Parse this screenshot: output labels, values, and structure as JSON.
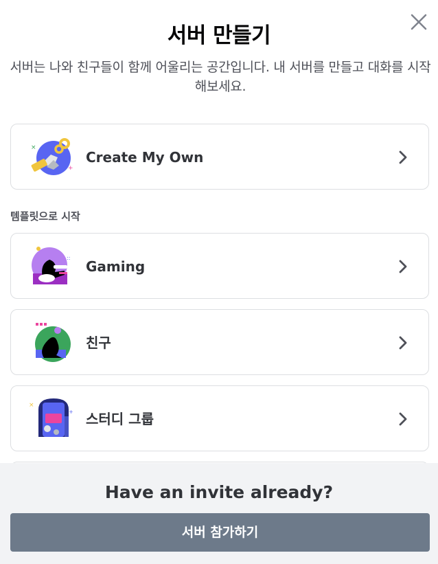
{
  "modal": {
    "title": "서버 만들기",
    "subtitle": "서버는 나와 친구들이 함께 어울리는 공간입니다. 내 서버를 만들고 대화를 시작해보세요.",
    "close_icon": "close-icon"
  },
  "create_own": {
    "label": "Create My Own",
    "icon": "create-server-icon"
  },
  "templates": {
    "heading": "템플릿으로 시작",
    "items": [
      {
        "label": "Gaming",
        "icon": "gaming-icon"
      },
      {
        "label": "친구",
        "icon": "friends-icon"
      },
      {
        "label": "스터디 그룹",
        "icon": "study-group-icon"
      }
    ]
  },
  "footer": {
    "title": "Have an invite already?",
    "join_label": "서버 참가하기"
  },
  "colors": {
    "join_button": "#6d7a8a",
    "card_border": "#dcdee1",
    "footer_bg": "#f2f3f5"
  }
}
